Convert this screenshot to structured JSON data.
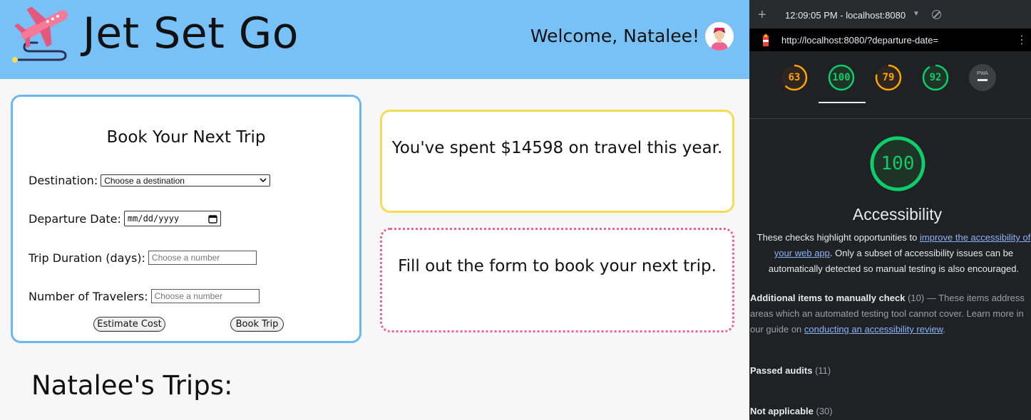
{
  "app": {
    "brand": "Jet Set Go",
    "welcome": "Welcome, Natalee!",
    "form": {
      "title": "Book Your Next Trip",
      "destination_label": "Destination:",
      "destination_value": "Choose a destination",
      "departure_label": "Departure Date:",
      "departure_value": "mm/dd/yyyy",
      "duration_label": "Trip Duration (days):",
      "duration_placeholder": "Choose a number",
      "travelers_label": "Number of Travelers:",
      "travelers_placeholder": "Choose a number",
      "estimate_button": "Estimate Cost",
      "book_button": "Book Trip"
    },
    "spent_message": "You've spent $14598 on travel this year.",
    "info_message": "Fill out the form to book your next trip.",
    "trips_title": "Natalee's Trips:"
  },
  "devtools": {
    "session": "12:09:05 PM - localhost:8080",
    "url": "http://localhost:8080/?departure-date=",
    "scores": [
      {
        "value": "63",
        "color": "#ffa400",
        "fraction": 0.63
      },
      {
        "value": "100",
        "color": "#0cce6b",
        "fraction": 1.0
      },
      {
        "value": "79",
        "color": "#ffa400",
        "fraction": 0.79
      },
      {
        "value": "92",
        "color": "#0cce6b",
        "fraction": 0.92
      }
    ],
    "pwa_label": "PWA",
    "accessibility_score": "100",
    "accessibility_title": "Accessibility",
    "desc_pre": "These checks highlight opportunities to ",
    "desc_link": "improve the accessibility of your web app",
    "desc_post": ". Only a subset of accessibility issues can be automatically detected so manual testing is also encouraged.",
    "manual_title": "Additional items to manually check",
    "manual_count": "(10)",
    "manual_dash": "—",
    "manual_text": "These items address areas which an automated testing tool cannot cover. Learn more in our guide on ",
    "manual_link": "conducting an accessibility review",
    "manual_end": ".",
    "passed_label": "Passed audits",
    "passed_count": "(11)",
    "na_label": "Not applicable",
    "na_count": "(30)"
  }
}
